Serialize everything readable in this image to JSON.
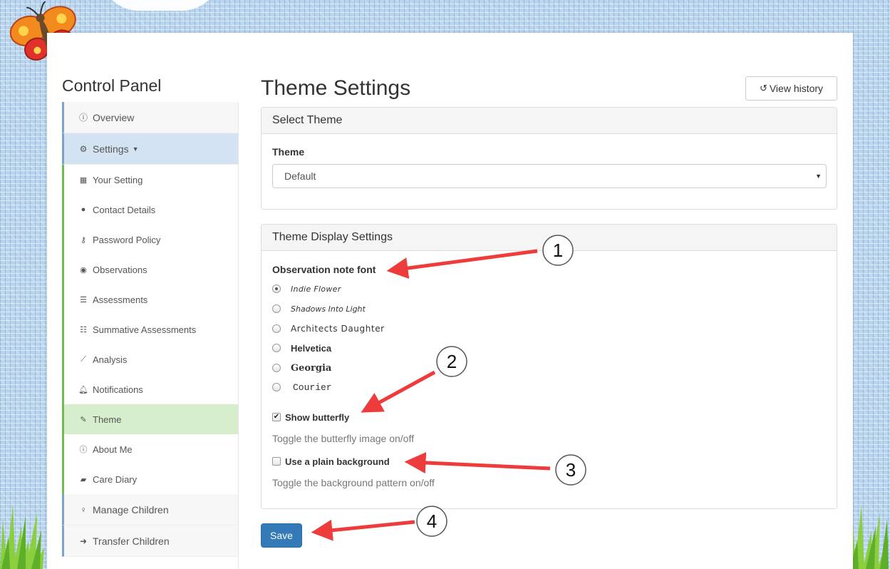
{
  "sidebar": {
    "title": "Control Panel",
    "items": [
      {
        "label": "Overview",
        "icon": "info-circle-icon"
      },
      {
        "label": "Settings",
        "icon": "gear-icon"
      }
    ],
    "settings_sub": [
      {
        "label": "Your Setting",
        "icon": "building-icon"
      },
      {
        "label": "Contact Details",
        "icon": "speech-bubble-icon"
      },
      {
        "label": "Password Policy",
        "icon": "key-icon"
      },
      {
        "label": "Observations",
        "icon": "eye-icon"
      },
      {
        "label": "Assessments",
        "icon": "list-icon"
      },
      {
        "label": "Summative Assessments",
        "icon": "th-list-icon"
      },
      {
        "label": "Analysis",
        "icon": "line-chart-icon"
      },
      {
        "label": "Notifications",
        "icon": "bell-icon"
      },
      {
        "label": "Theme",
        "icon": "paintbrush-icon"
      },
      {
        "label": "About Me",
        "icon": "info-circle-icon"
      },
      {
        "label": "Care Diary",
        "icon": "book-icon"
      }
    ],
    "bottom_items": [
      {
        "label": "Manage Children",
        "icon": "child-icon"
      },
      {
        "label": "Transfer Children",
        "icon": "arrow-circle-icon"
      }
    ]
  },
  "main": {
    "title": "Theme Settings",
    "view_history": "View history",
    "select_theme": {
      "heading": "Select Theme",
      "label": "Theme",
      "value": "Default"
    },
    "display": {
      "heading": "Theme Display Settings",
      "font_label": "Observation note font",
      "fonts": [
        "Indie Flower",
        "Shadows Into Light",
        "Architects Daughter",
        "Helvetica",
        "Georgia",
        "Courier"
      ],
      "selected_font": "Indie Flower",
      "butterfly_label": "Show butterfly",
      "butterfly_checked": true,
      "butterfly_help": "Toggle the butterfly image on/off",
      "plain_bg_label": "Use a plain background",
      "plain_bg_checked": false,
      "plain_bg_help": "Toggle the background pattern on/off"
    },
    "save": "Save"
  },
  "annotations": [
    "1",
    "2",
    "3",
    "4"
  ],
  "colors": {
    "primary": "#337ab7",
    "active_settings": "#d4e3f3",
    "active_theme": "#d6eecb",
    "arrow": "#ee3b3b"
  }
}
